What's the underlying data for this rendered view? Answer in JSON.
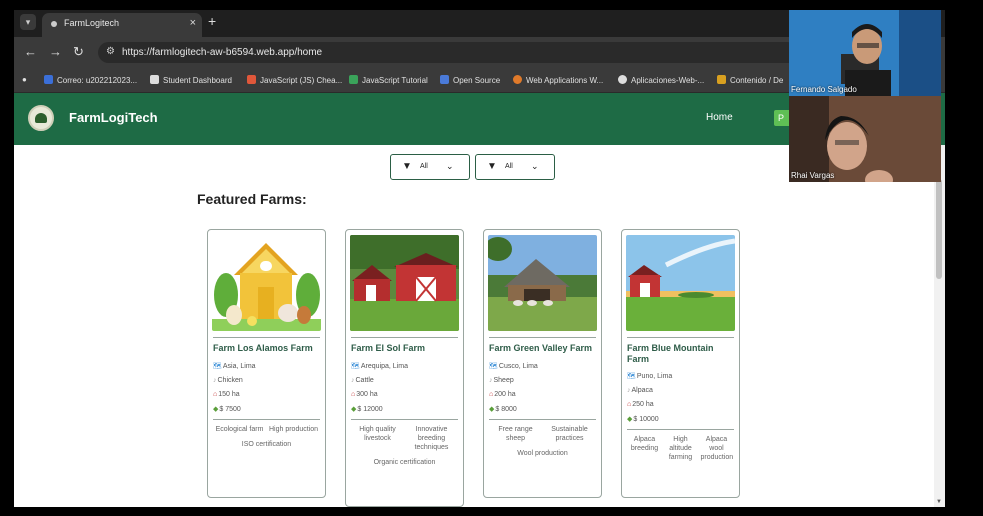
{
  "browser": {
    "tab_title": "FarmLogitech",
    "tab_close": "×",
    "tab_new": "+",
    "url": "https://farmlogitech-aw-b6594.web.app/home",
    "bookmarks": [
      {
        "label": "Correo: u202212023...",
        "color": "#3b6fd8"
      },
      {
        "label": "Student Dashboard",
        "color": "#dddddd"
      },
      {
        "label": "JavaScript (JS) Chea...",
        "color": "#e0573a"
      },
      {
        "label": "JavaScript Tutorial",
        "color": "#3aa35a"
      },
      {
        "label": "Open Source",
        "color": "#4a7ad8"
      },
      {
        "label": "Web Applications W...",
        "color": "#e07a2a"
      },
      {
        "label": "Aplicaciones-Web-...",
        "color": "#dddddd"
      },
      {
        "label": "Contenido / De",
        "color": "#d8a020"
      }
    ]
  },
  "app": {
    "brand": "FarmLogiTech",
    "nav_home": "Home",
    "nav_partial": "P"
  },
  "filters": [
    {
      "value": "All"
    },
    {
      "value": "All"
    }
  ],
  "section_title": "Featured Farms:",
  "farms": [
    {
      "name": "Farm Los Alamos Farm",
      "location": "Asia, Lima",
      "animal": "Chicken",
      "area": "150 ha",
      "price": "$ 7500",
      "features": [
        "Ecological farm",
        "High production"
      ],
      "certification": "ISO certification"
    },
    {
      "name": "Farm El Sol Farm",
      "location": "Arequipa, Lima",
      "animal": "Cattle",
      "area": "300 ha",
      "price": "$ 12000",
      "features": [
        "High quality livestock",
        "Innovative breeding techniques"
      ],
      "certification": "Organic certification"
    },
    {
      "name": "Farm Green Valley Farm",
      "location": "Cusco, Lima",
      "animal": "Sheep",
      "area": "200 ha",
      "price": "$ 8000",
      "features": [
        "Free range sheep",
        "Sustainable practices"
      ],
      "certification": "Wool production"
    },
    {
      "name": "Farm Blue Mountain Farm",
      "location": "Puno, Lima",
      "animal": "Alpaca",
      "area": "250 ha",
      "price": "$ 10000",
      "features": [
        "Alpaca breeding",
        "High altitude farming",
        "Alpaca wool production"
      ],
      "certification": ""
    }
  ],
  "video_call": [
    {
      "name": "Fernando Salgado"
    },
    {
      "name": "Rhai Vargas"
    }
  ]
}
